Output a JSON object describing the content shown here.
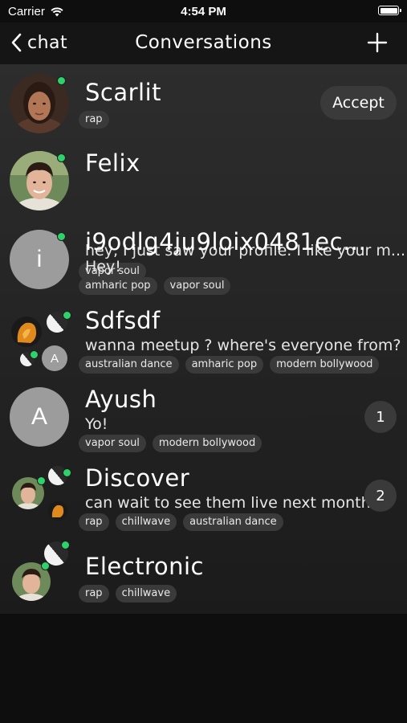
{
  "status_bar": {
    "carrier": "Carrier",
    "time": "4:54 PM"
  },
  "nav": {
    "back_label": "chat",
    "title": "Conversations"
  },
  "conversations": [
    {
      "name": "Scarlit",
      "message": "",
      "tags": [
        "rap"
      ],
      "action": "Accept"
    },
    {
      "name": "Felix",
      "message": "hey, I just saw your profile. I like your m...",
      "tags": [
        "vapor soul"
      ]
    },
    {
      "name": "i9odlg4ju9loix0481ec...",
      "message": "Hey!",
      "tags": [
        "amharic pop",
        "vapor soul"
      ],
      "avatar_letter": "i"
    },
    {
      "name": "Sdfsdf",
      "message": "wanna meetup ? where's everyone from?",
      "tags": [
        "australian dance",
        "amharic pop",
        "modern bollywood"
      ],
      "member_letter": "A"
    },
    {
      "name": "Ayush",
      "message": "Yo!",
      "tags": [
        "vapor soul",
        "modern bollywood"
      ],
      "avatar_letter": "A",
      "unread": "1"
    },
    {
      "name": "Discover",
      "message": "can wait to see them live next month!",
      "tags": [
        "rap",
        "chillwave",
        "australian dance"
      ],
      "unread": "2"
    },
    {
      "name": "Electronic",
      "message": "",
      "tags": [
        "rap",
        "chillwave"
      ]
    }
  ]
}
